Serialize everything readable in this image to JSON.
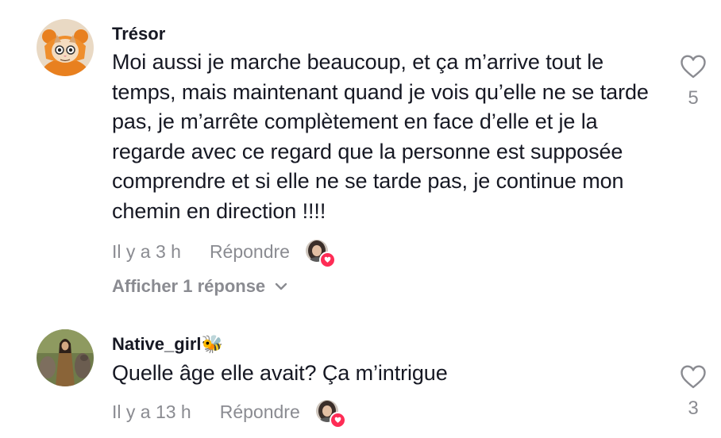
{
  "comments": [
    {
      "username": "Trésor",
      "avatar_icon": "cat-in-orange-hoodie-avatar",
      "text": "Moi aussi je marche beaucoup, et ça m’arrive tout le temps, mais maintenant quand je vois qu’elle ne se tarde pas, je m’arrête complètement en face d’elle et je la regarde avec ce regard que la personne est supposée comprendre et si elle ne se tarde pas, je continue mon chemin en direction !!!!",
      "time": "Il y a 3 h",
      "reply_label": "Répondre",
      "like_count": "5",
      "creator_liked": true,
      "view_replies_label": "Afficher 1 réponse"
    },
    {
      "username": "Native_girl🐝",
      "avatar_icon": "woman-with-wolves-avatar",
      "text": "Quelle âge elle avait? Ça m’intrigue",
      "time": "Il y a 13 h",
      "reply_label": "Répondre",
      "like_count": "3",
      "creator_liked": true
    }
  ],
  "colors": {
    "text_primary": "#161823",
    "text_secondary": "#8a8b91",
    "creator_heart": "#fe2c55"
  }
}
